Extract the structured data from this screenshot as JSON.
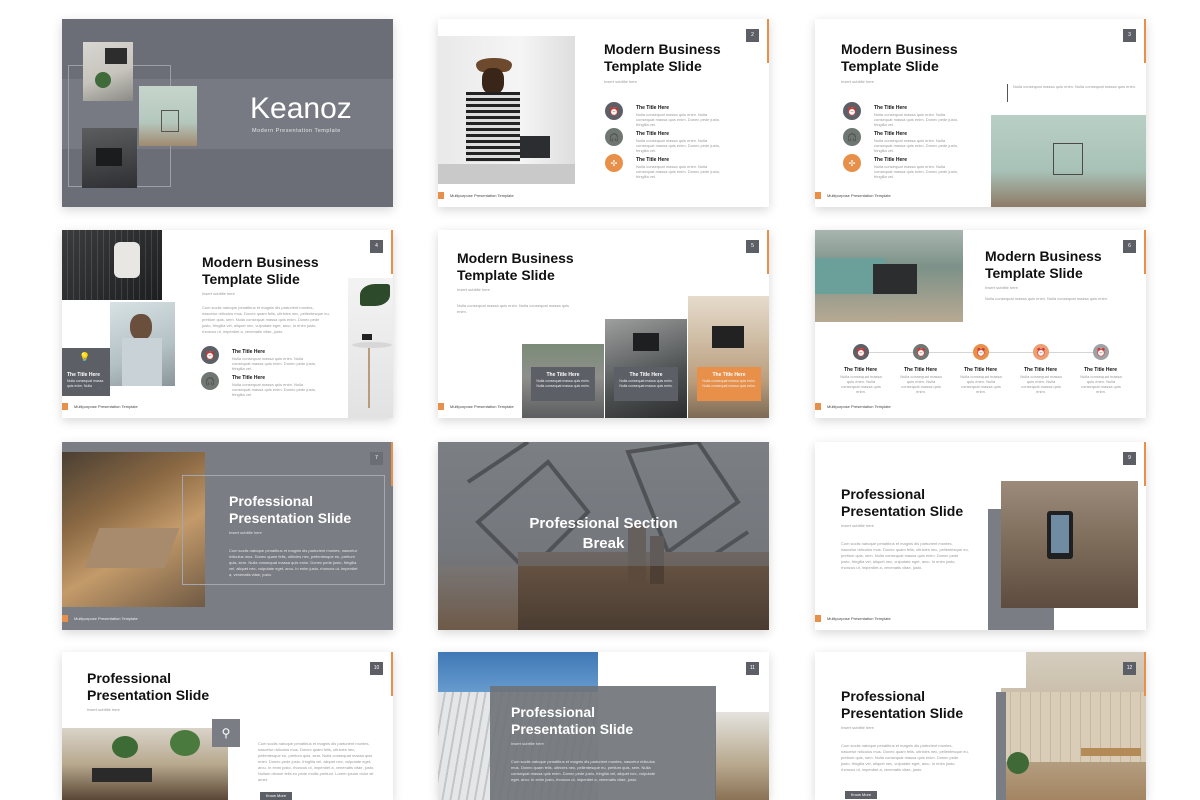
{
  "footer": "Multipurpose Presentation Template",
  "lorem_short": "Nulla consequat massa quis enim. Nulla consequat massa quis enim.",
  "lorem_item": "Nulla consequat massa quis enim. Nulla consequat massa quis enim. Donec pede justo, fringilla vel.",
  "lorem_para": "Cum sociis natoque penatibus et magnis dis parturient montes, nascetur ridiculus mus. Donec quam felis, ultricies nec, pellentesque eu, pretium quis, sem. Nulla consequat massa quis enim. Donec pede justo, fringilla vel, aliquet nec, vulputate eget, arcu. In enim justo, rhoncus ut, imperdiet a, venenatis vitae, justo.",
  "lorem_para_long": "Cum sociis natoque penatibus et magnis dis parturient montes, nascetur ridiculus mus. Donec quam felis, ultricies nec, pellentesque eu, pretium quis, sem. Nulla consequat massa quis enim. Donec pede justo, fringilla vel, aliquet nec, vulputate eget, arcu. In enim justo, rhoncus ut, imperdiet a, venenatis vitae, justo. Nullam dictum felis eu pede mollis pretium. Lorem ipsum dolor sit amet.",
  "item_title": "The Title Here",
  "subtitle": "Insert subtitle here",
  "know_more": "Know More",
  "colors": {
    "accent": "#e8904a",
    "slate": "#5d5f66",
    "grey_bg": "#7a7d84"
  },
  "slide1": {
    "brand": "Keanoz",
    "tagline": "Modern Presentation Template"
  },
  "slide2": {
    "num": "2",
    "title_line1": "Modern Business",
    "title_line2": "Template Slide",
    "icons": [
      "alarm-icon",
      "headphones-icon",
      "expand-icon"
    ]
  },
  "slide3": {
    "num": "3",
    "title_line1": "Modern Business",
    "title_line2": "Template Slide",
    "icons": [
      "alarm-icon",
      "headphones-icon",
      "expand-icon"
    ]
  },
  "slide4": {
    "num": "4",
    "title_line1": "Modern Business",
    "title_line2": "Template Slide"
  },
  "slide5": {
    "num": "5",
    "title_line1": "Modern Business",
    "title_line2": "Template Slide"
  },
  "slide6": {
    "num": "6",
    "title_line1": "Modern Business",
    "title_line2": "Template Slide"
  },
  "slide7": {
    "num": "7",
    "title_line1": "Professional",
    "title_line2": "Presentation Slide"
  },
  "slide8": {
    "title_line1": "Professional Section",
    "title_line2": "Break"
  },
  "slide9": {
    "num": "9",
    "title_line1": "Professional",
    "title_line2": "Presentation Slide"
  },
  "slide10": {
    "num": "10",
    "title_line1": "Professional",
    "title_line2": "Presentation Slide"
  },
  "slide11": {
    "num": "11",
    "title_line1": "Professional",
    "title_line2": "Presentation Slide"
  },
  "slide12": {
    "num": "12",
    "title_line1": "Professional",
    "title_line2": "Presentation Slide"
  }
}
